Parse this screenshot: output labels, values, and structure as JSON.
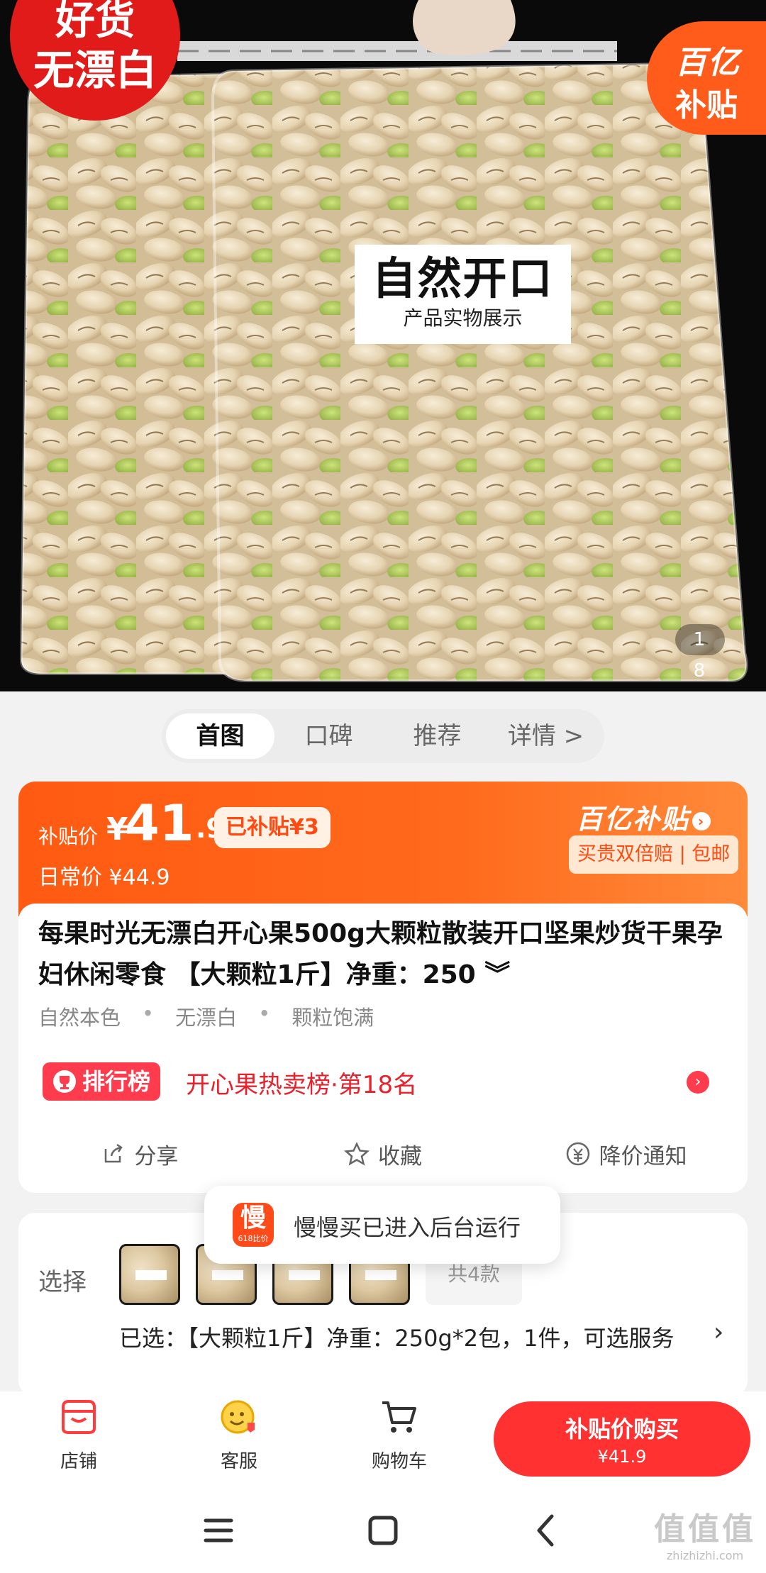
{
  "hero": {
    "badge_left_line1": "好货",
    "badge_left_line2": "无漂白",
    "badge_right_line1": "百亿",
    "badge_right_line2": "补贴",
    "sticker_title": "自然开口",
    "sticker_sub": "产品实物展示",
    "page_indicator": "1 8"
  },
  "tabs": [
    {
      "label": "首图",
      "active": true
    },
    {
      "label": "口碑",
      "active": false
    },
    {
      "label": "推荐",
      "active": false
    },
    {
      "label": "详情 >",
      "active": false
    }
  ],
  "price": {
    "subsidy_label": "补贴价",
    "yen": "¥",
    "price_int": "41",
    "price_dec": ".9",
    "saved": "已补贴¥3",
    "daily_price": "日常价 ¥44.9",
    "subsidy_logo": "百亿补贴",
    "subsidy_logo_arrow": "›",
    "guarantee": "买贵双倍赔 | 包邮"
  },
  "product": {
    "title": "每果时光无漂白开心果500g大颗粒散装开口坚果炒货干果孕妇休闲零食 【大颗粒1斤】净重：250 ︾",
    "tags": [
      "自然本色",
      "无漂白",
      "颗粒饱满"
    ],
    "tag_separator": "•",
    "rank_badge": "排行榜",
    "rank_text": "开心果热卖榜·第18名",
    "rank_arrow": "›"
  },
  "actions": [
    {
      "label": "分享",
      "icon": "share-icon"
    },
    {
      "label": "收藏",
      "icon": "star-icon"
    },
    {
      "label": "降价通知",
      "icon": "price-drop-icon"
    }
  ],
  "options": {
    "label": "选择",
    "count": "共4款",
    "selected": "已选：【大颗粒1斤】净重：250g*2包，1件，可选服务",
    "chevron": "›"
  },
  "toast": {
    "icon_glyph": "慢",
    "icon_sub": "618比价",
    "message": "慢慢买已进入后台运行"
  },
  "bottom_bar": {
    "shop": "店铺",
    "service": "客服",
    "cart": "购物车",
    "buy_label": "补贴价购买",
    "buy_price": "¥41.9"
  },
  "watermark": {
    "line1": "值值值",
    "line2": "zhizhizhi.com"
  },
  "colors": {
    "accent": "#ff5a12",
    "buy_button": "#ff3131",
    "rank": "#ff3b4e"
  }
}
